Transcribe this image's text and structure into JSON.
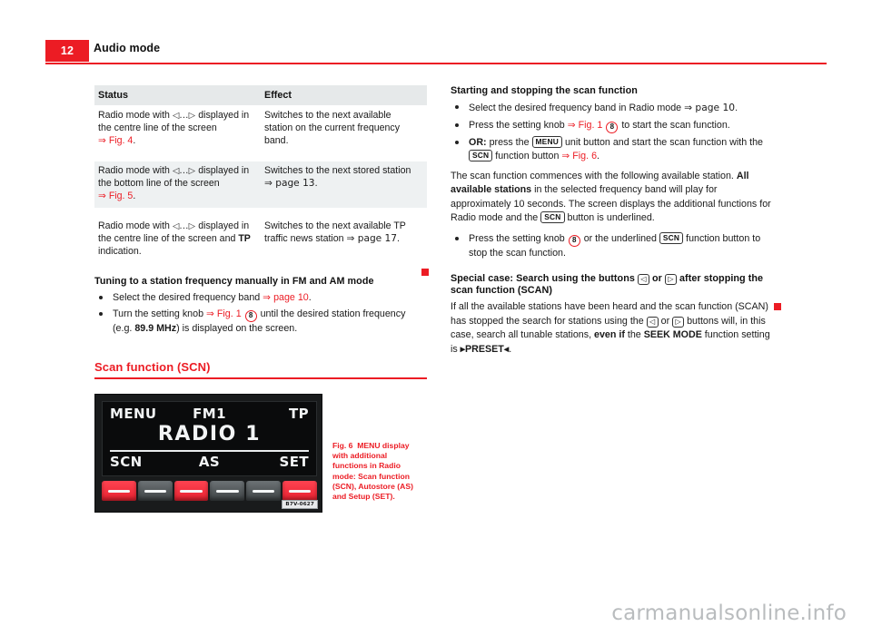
{
  "header": {
    "page_number": "12",
    "title": "Audio mode",
    "accent_color": "#ec1c24"
  },
  "table": {
    "columns": [
      "Status",
      "Effect"
    ],
    "rows": [
      {
        "status_pre": "Radio mode with ",
        "status_sym": "◁...▷",
        "status_mid": " displayed in the centre line of the screen ",
        "status_xref": "⇒ Fig. 4",
        "status_post": ".",
        "effect": "Switches to the next available station on the current frequency band."
      },
      {
        "status_pre": "Radio mode with ",
        "status_sym": "◁...▷",
        "status_mid": " displayed in the bottom line of the screen ",
        "status_xref": "⇒ Fig. 5",
        "status_post": ".",
        "effect_pre": "Switches to the next stored station ",
        "effect_xref": "⇒ page 13",
        "effect_post": "."
      },
      {
        "status_pre": "Radio mode with ",
        "status_sym": "◁...▷",
        "status_mid": " displayed in the centre line of the screen and ",
        "status_bold": "TP",
        "status_post": " indication.",
        "effect_pre": "Switches to the next available TP traffic news station ",
        "effect_xref": "⇒ page 17",
        "effect_post": "."
      }
    ]
  },
  "left_column": {
    "tuning": {
      "heading": "Tuning to a station frequency manually in FM and AM mode",
      "bullet1_text": "Select the desired frequency band ",
      "bullet1_xref": "⇒ page 10",
      "bullet1_post": ".",
      "bullet2_pre": "Turn the setting knob ",
      "bullet2_xref": "⇒ Fig. 1",
      "bullet2_knob": "8",
      "bullet2_mid": " until the desired station frequency (e.g. ",
      "bullet2_bold": "89.9 MHz",
      "bullet2_post": ") is displayed on the screen."
    },
    "scan_section": {
      "title": "Scan function (SCN)"
    },
    "figure": {
      "caption_label": "Fig. 6",
      "caption_text": "MENU display with additional functions in Radio mode: Scan function (SCN), Autostore (AS) and Setup (SET).",
      "code": "B7V-0627",
      "screen": {
        "menu": "MENU",
        "band": "FM1",
        "tp": "TP",
        "station": "RADIO 1",
        "scn": "SCN",
        "as": "AS",
        "set": "SET"
      },
      "buttons": [
        "red",
        "grey",
        "red",
        "grey",
        "grey",
        "red"
      ]
    }
  },
  "right_column": {
    "scan_start": {
      "heading": "Starting and stopping the scan function",
      "bullet1_pre": "Select the desired frequency band in Radio mode ",
      "bullet1_xref": "⇒ page 10",
      "bullet1_post": ".",
      "bullet2_pre": "Press the setting knob ",
      "bullet2_xref": "⇒ Fig. 1",
      "bullet2_knob": "8",
      "bullet2_post": " to start the scan function.",
      "bullet3_or": "OR:",
      "bullet3_pre": " press the ",
      "bullet3_btn1": "MENU",
      "bullet3_mid": " unit button and start the scan function with the ",
      "bullet3_btn2": "SCN",
      "bullet3_mid2": " function button ",
      "bullet3_xref": "⇒ Fig. 6",
      "bullet3_post": "."
    },
    "scan_body": {
      "p1_pre": "The scan function commences with the following available station. ",
      "p1_bold": "All available stations",
      "p1_mid": " in the selected frequency band will play for approximately 10 seconds. The screen displays the additional functions for Radio mode and the ",
      "p1_btn": "SCN",
      "p1_post": " button is underlined.",
      "bullet_pre": "Press the setting knob ",
      "bullet_knob": "8",
      "bullet_mid": " or the underlined ",
      "bullet_btn": "SCN",
      "bullet_post": " function button to stop the scan function."
    },
    "special_case": {
      "heading_pre": "Special case: Search using the buttons ",
      "heading_btn1": "◁",
      "heading_mid": " or ",
      "heading_btn2": "▷",
      "heading_post": " after stopping the scan function (SCAN)",
      "p_pre": "If all the available stations have been heard and the scan function (SCAN) has stopped the search for stations using the ",
      "p_btn1": "◁",
      "p_mid": " or ",
      "p_btn2": "▷",
      "p_mid2": " buttons will, in this case, search all tunable stations, ",
      "p_bold1": "even if",
      "p_mid3": " the ",
      "p_bold2": "SEEK MODE",
      "p_mid4": " function setting is ",
      "p_bold3": "▸PRESET◂",
      "p_post": "."
    }
  },
  "watermark": "carmanualsonline.info"
}
